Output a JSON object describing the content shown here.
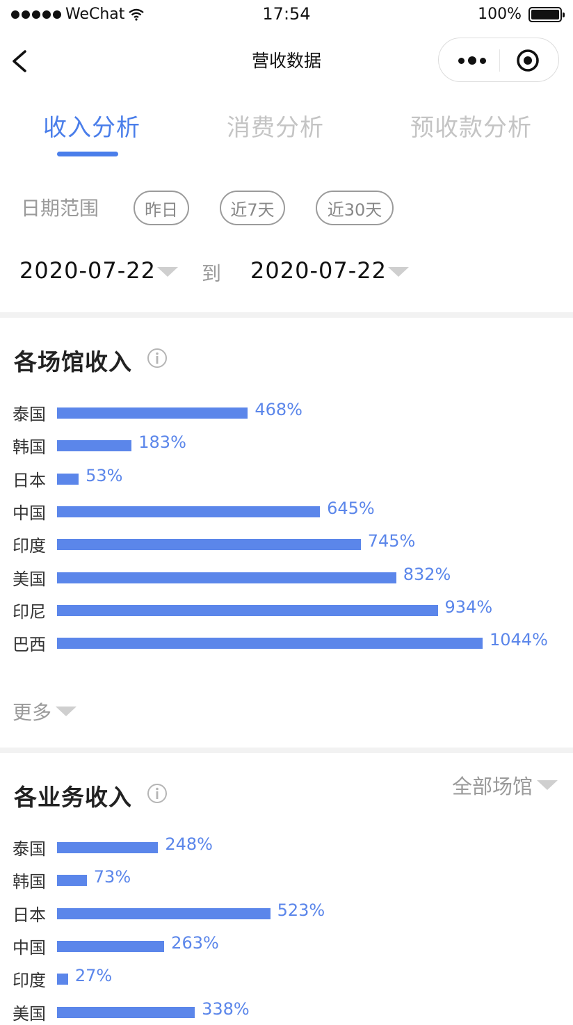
{
  "status_bar": {
    "carrier": "WeChat",
    "time": "17:54",
    "battery": "100%"
  },
  "navbar": {
    "title": "营收数据"
  },
  "tabs": [
    {
      "label": "收入分析",
      "active": true
    },
    {
      "label": "消费分析",
      "active": false
    },
    {
      "label": "预收款分析",
      "active": false
    }
  ],
  "date_range": {
    "label": "日期范围",
    "chips": [
      "昨日",
      "近7天",
      "近30天"
    ],
    "start": "2020-07-22",
    "to": "到",
    "end": "2020-07-22"
  },
  "venue_income": {
    "title": "各场馆收入",
    "more": "更多"
  },
  "business_income": {
    "title": "各业务收入",
    "venue_filter": "全部场馆"
  },
  "colors": {
    "accent": "#4a7eea",
    "bar": "#5b86ea",
    "inactive_tab": "#c4c4c4"
  },
  "icons": {
    "back": "chevron-left-icon",
    "more": "more-dots-icon",
    "close": "target-close-icon",
    "info": "info-icon"
  },
  "chart_data": [
    {
      "type": "bar",
      "orientation": "horizontal",
      "title": "各场馆收入",
      "categories": [
        "泰国",
        "韩国",
        "日本",
        "中国",
        "印度",
        "美国",
        "印尼",
        "巴西"
      ],
      "values": [
        468,
        183,
        53,
        645,
        745,
        832,
        934,
        1044
      ],
      "labels": [
        "468%",
        "183%",
        "53%",
        "645%",
        "745%",
        "832%",
        "934%",
        "1044%"
      ],
      "unit": "%"
    },
    {
      "type": "bar",
      "orientation": "horizontal",
      "title": "各业务收入",
      "categories": [
        "泰国",
        "韩国",
        "日本",
        "中国",
        "印度",
        "美国"
      ],
      "values": [
        248,
        73,
        523,
        263,
        27,
        338
      ],
      "labels": [
        "248%",
        "73%",
        "523%",
        "263%",
        "27%",
        "338%"
      ],
      "unit": "%"
    }
  ]
}
